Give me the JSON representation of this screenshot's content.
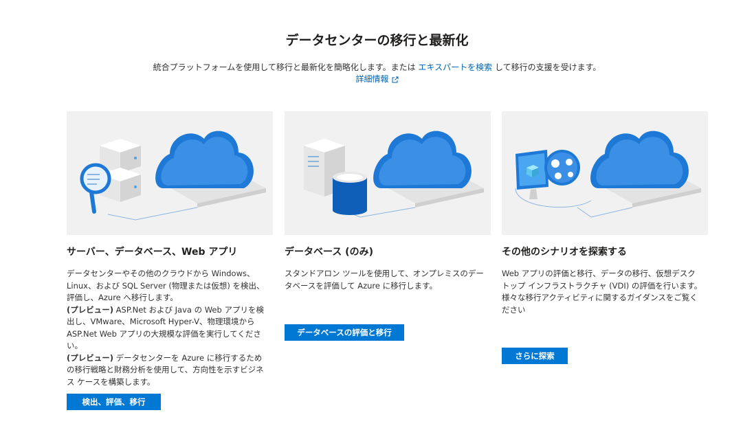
{
  "page": {
    "title": "データセンターの移行と最新化",
    "subtitle_before": "統合プラットフォームを使用して移行と最新化を簡略化します。または ",
    "subtitle_link": "エキスパートを検索",
    "subtitle_after": " して移行の支援を受けます。",
    "learn_more": "詳細情報"
  },
  "cards": [
    {
      "title": "サーバー、データベース、Web アプリ",
      "desc_1": "データセンターやその他のクラウドから Windows、Linux、および SQL Server (物理または仮想) を検出、評価し、Azure へ移行します。",
      "desc_2_bold": "(プレビュー)",
      "desc_2": " ASP.Net および Java の Web アプリを検出し、VMware、Microsoft Hyper-V、物理環境から ASP.Net Web アプリの大規模な評価を実行してください。",
      "desc_3_bold": "(プレビュー)",
      "desc_3": " データセンターを Azure に移行するための移行戦略と財務分析を使用して、方向性を示すビジネス ケースを構築します。",
      "button": "検出、評価、移行"
    },
    {
      "title": "データベース (のみ)",
      "desc_1": "スタンドアロン ツールを使用して、オンプレミスのデータベースを評価して Azure に移行します。",
      "button": "データベースの評価と移行"
    },
    {
      "title": "その他のシナリオを探索する",
      "desc_1": "Web アプリの評価と移行、データの移行、仮想デスクトップ インフラストラクチャ (VDI) の評価を行います。",
      "desc_2": "様々な移行アクティビティに関するガイダンスをご覧ください",
      "button": "さらに探索"
    }
  ],
  "icons": {
    "learn_more": "external-link-icon",
    "card_1": "servers-magnifier-cloud-icon",
    "card_2": "server-database-cloud-icon",
    "card_3": "desktop-cloud-icon"
  },
  "colors": {
    "accent": "#0078d4",
    "link": "#0063b1",
    "hero_bg": "#f1f1f1"
  }
}
